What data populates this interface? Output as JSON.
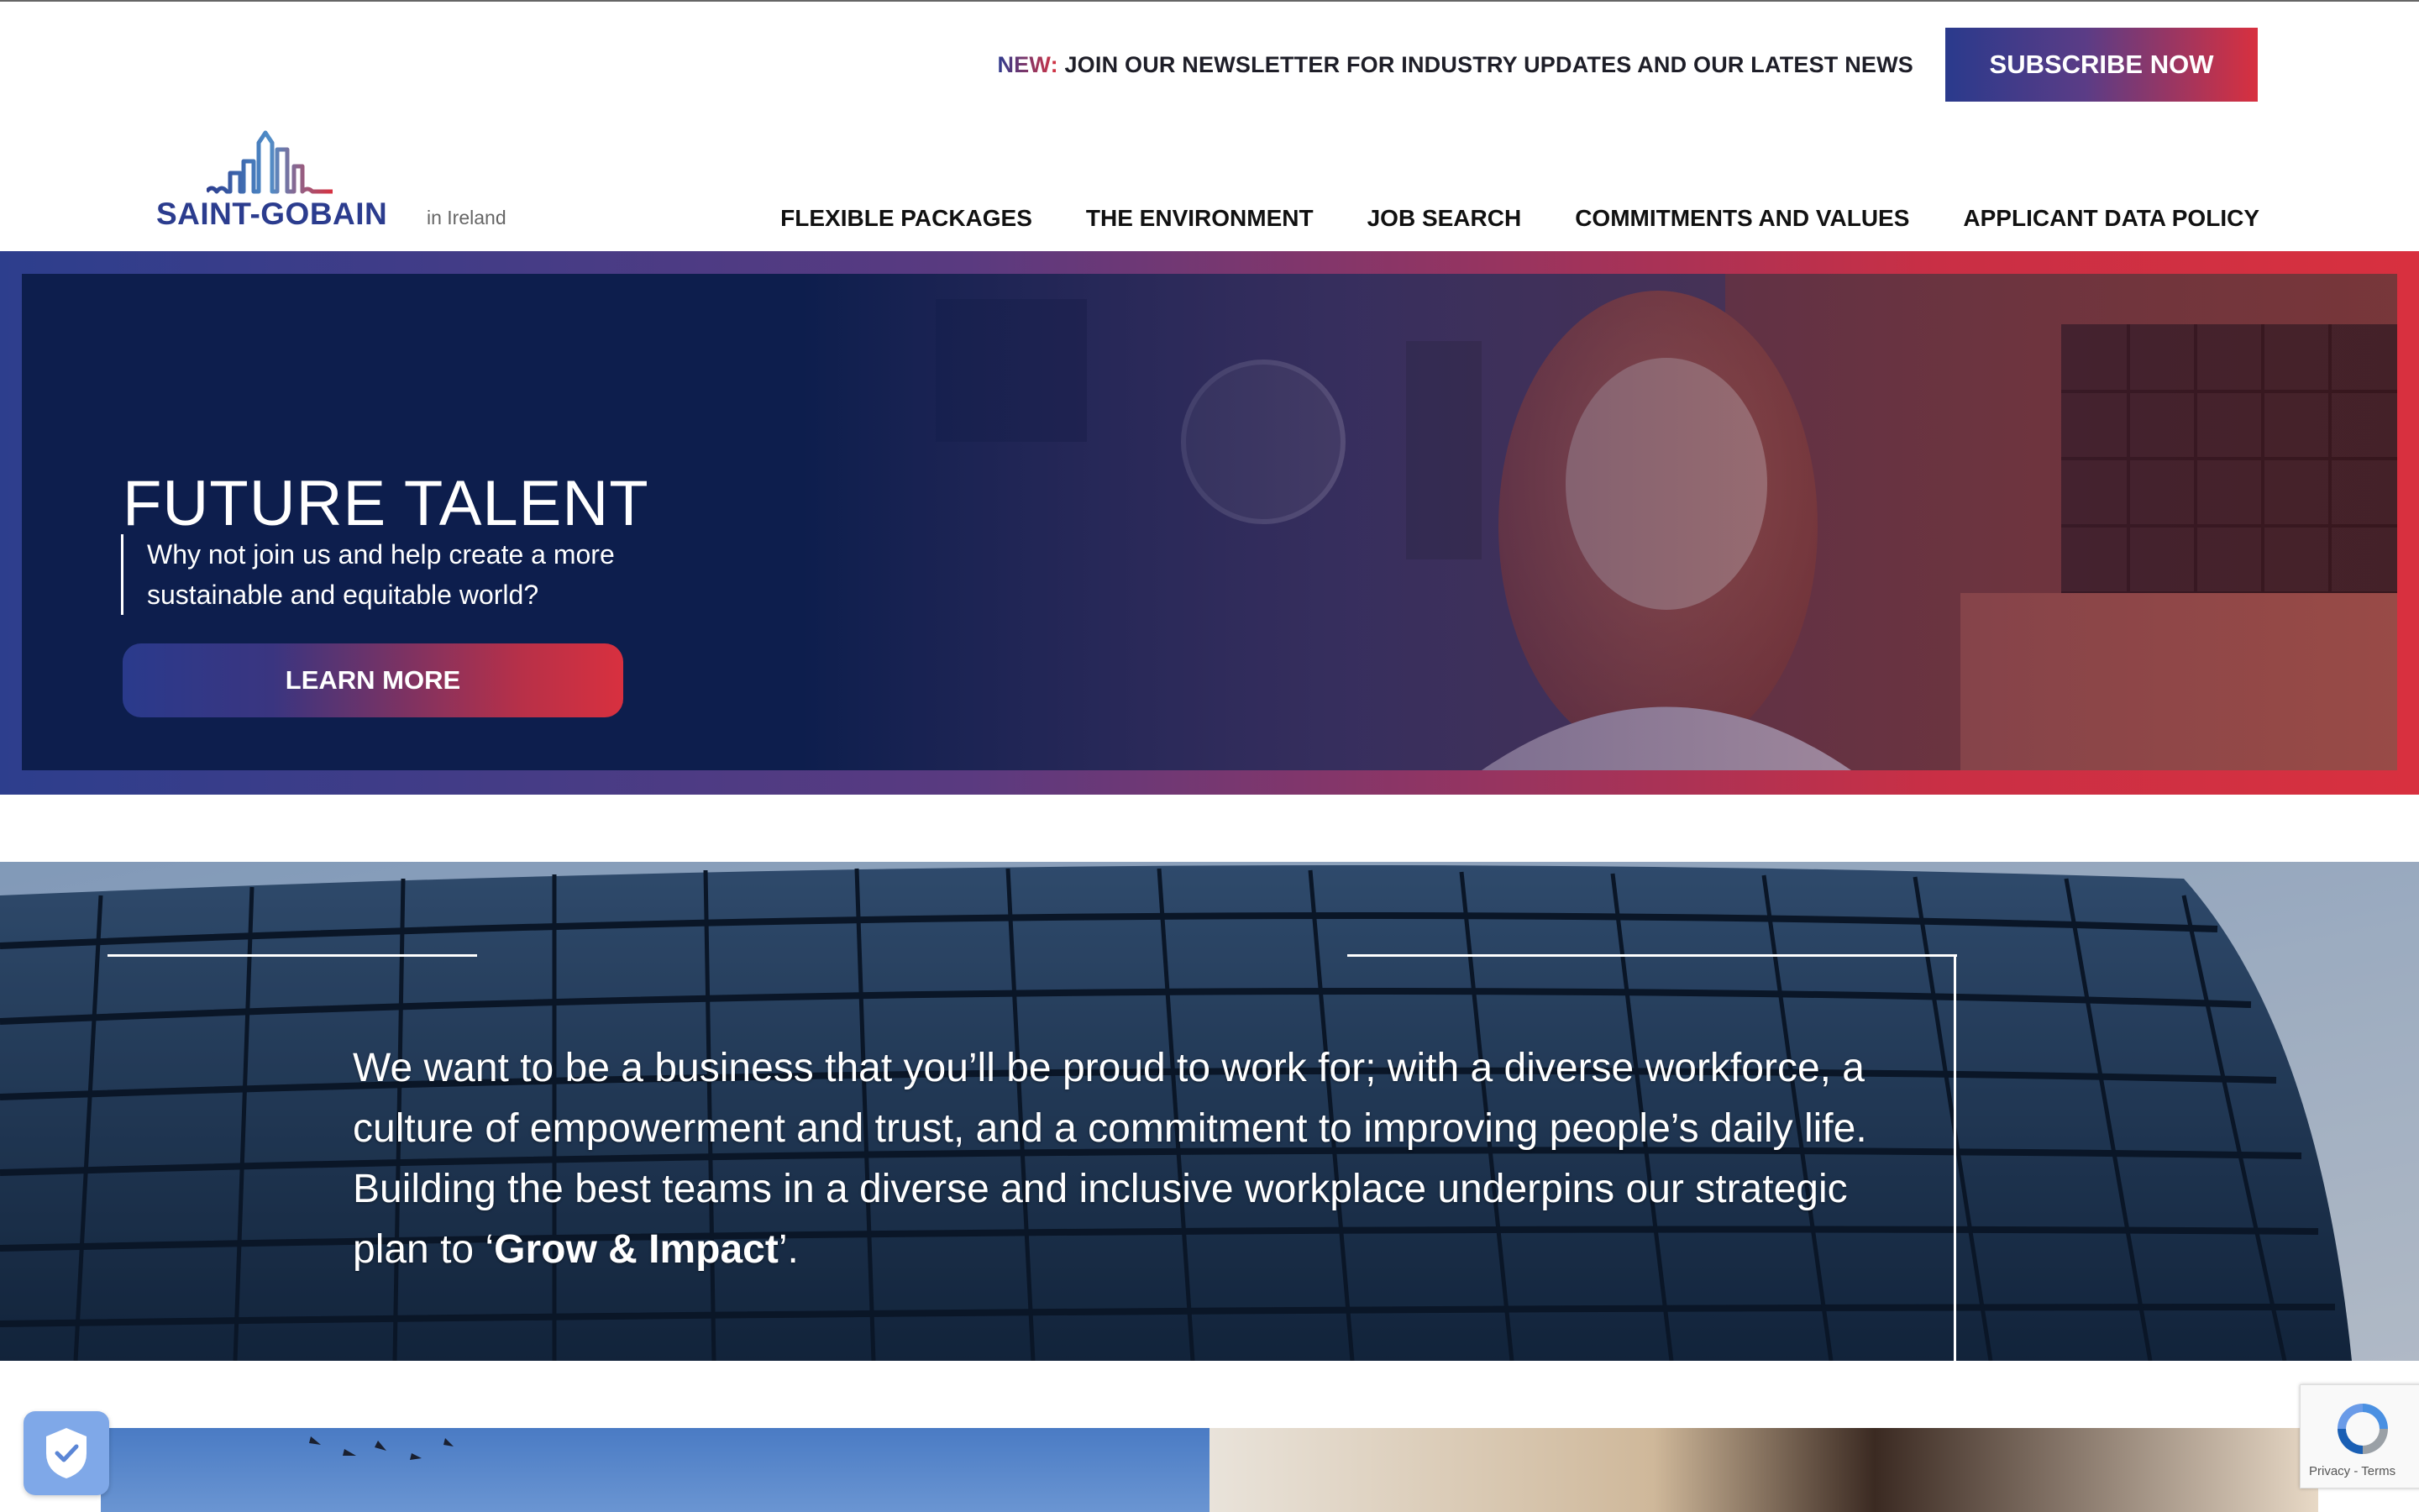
{
  "newsletter": {
    "prefix": "NEW:",
    "text": "JOIN OUR NEWSLETTER FOR INDUSTRY UPDATES AND OUR LATEST NEWS",
    "button": "SUBSCRIBE NOW"
  },
  "brand": {
    "name": "SAINT-GOBAIN",
    "country": "in Ireland"
  },
  "nav": {
    "items": [
      {
        "label": "FLEXIBLE PACKAGES"
      },
      {
        "label": "THE ENVIRONMENT"
      },
      {
        "label": "JOB SEARCH"
      },
      {
        "label": "COMMITMENTS AND VALUES"
      },
      {
        "label": "APPLICANT DATA POLICY"
      }
    ]
  },
  "hero": {
    "title": "FUTURE TALENT",
    "subtitle": "Why not join us and help create a more sustainable and equitable world?",
    "button": "LEARN MORE"
  },
  "quote": {
    "text": "We want to be a business that you’ll be proud to work for; with a diverse workforce, a culture of empowerment and trust, and a commitment to improving people’s daily life. Building the best teams in a diverse and inclusive workplace underpins our strategic plan to ‘",
    "emphasis": "Grow & Impact",
    "suffix": "’."
  },
  "recaptcha": {
    "footer": "Privacy - Terms"
  },
  "colors": {
    "brand_blue": "#2b3c8e",
    "brand_red": "#d8303f",
    "hero_navy": "#0d1e4d"
  },
  "icons": {
    "logo": "saint-gobain-skyline-logo",
    "shield": "shield-check-icon",
    "recaptcha": "recaptcha-icon"
  }
}
